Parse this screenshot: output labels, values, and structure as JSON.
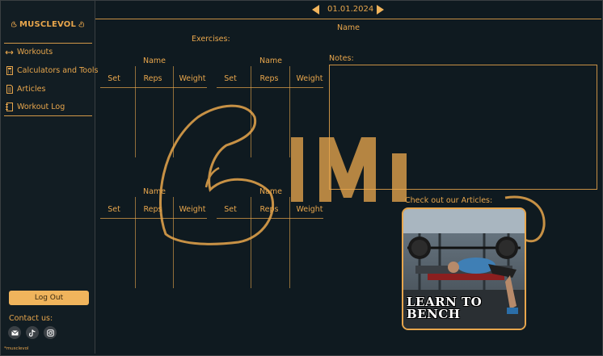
{
  "app": {
    "logo_text": "MUSCLEVOL"
  },
  "sidebar": {
    "items": [
      {
        "label": "Workouts",
        "icon": "arrows-icon"
      },
      {
        "label": "Calculators and Tools",
        "icon": "calculator-icon"
      },
      {
        "label": "Articles",
        "icon": "document-icon"
      },
      {
        "label": "Workout Log",
        "icon": "notebook-icon"
      }
    ],
    "logout_label": "Log Out",
    "contact_label": "Contact us:",
    "footer_handle": "*musclevol"
  },
  "header": {
    "date": "01.01.2024"
  },
  "main": {
    "name_label": "Name",
    "exercises_label": "Exercises:",
    "exercise_blocks": [
      {
        "name": "Name",
        "columns": [
          "Set",
          "Reps",
          "Weight"
        ]
      },
      {
        "name": "Name",
        "columns": [
          "Set",
          "Reps",
          "Weight"
        ]
      },
      {
        "name": "Name",
        "columns": [
          "Set",
          "Reps",
          "Weight"
        ]
      },
      {
        "name": "Name",
        "columns": [
          "Set",
          "Reps",
          "Weight"
        ]
      }
    ],
    "notes_label": "Notes:",
    "articles_label": "Check out our Articles:",
    "article_card_title": "LEARN TO BENCH"
  },
  "colors": {
    "accent": "#e8a64c",
    "background": "#0f1a20",
    "sidebar": "#121d23",
    "button": "#f0b45c"
  }
}
